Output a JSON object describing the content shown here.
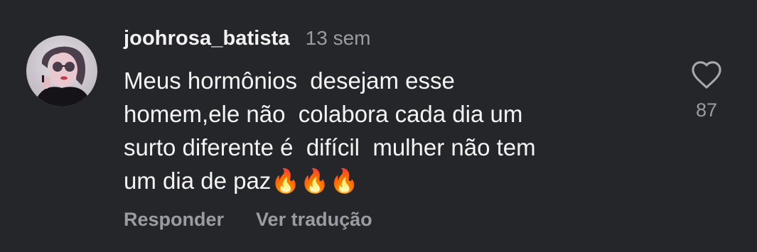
{
  "comment": {
    "username": "joohrosa_batista",
    "timestamp": "13 sem",
    "lines": [
      "Meus hormônios  desejam esse",
      "homem,ele não  colabora cada dia um",
      "surto diferente é  difícil  mulher não tem",
      "um dia de paz🔥🔥🔥"
    ],
    "actions": {
      "reply": "Responder",
      "translate": "Ver tradução"
    },
    "likes": {
      "count": "87",
      "icon": "heart-outline-icon"
    },
    "avatar": {
      "icon": "profile-photo"
    }
  },
  "colors": {
    "background": "#25262a",
    "text": "#f4f4f4",
    "muted": "#9a9ca2"
  }
}
